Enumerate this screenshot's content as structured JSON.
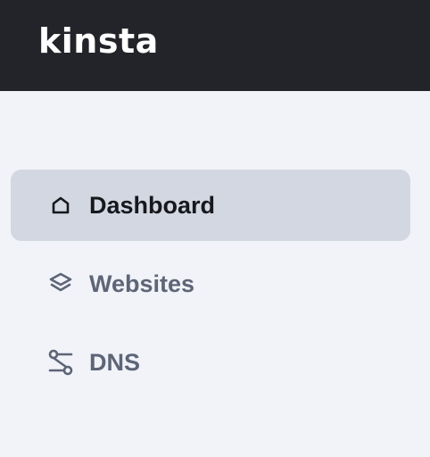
{
  "brand": {
    "logo_text": "kinsta"
  },
  "nav": {
    "items": [
      {
        "label": "Dashboard",
        "icon": "home-icon",
        "active": true
      },
      {
        "label": "Websites",
        "icon": "layers-icon",
        "active": false
      },
      {
        "label": "DNS",
        "icon": "route-icon",
        "active": false
      }
    ]
  },
  "colors": {
    "topbar": "#232429",
    "sidebar_bg": "#f1f3f8",
    "active_bg": "#d3d7e1",
    "active_text": "#17181d",
    "inactive_text": "#5d6577"
  }
}
